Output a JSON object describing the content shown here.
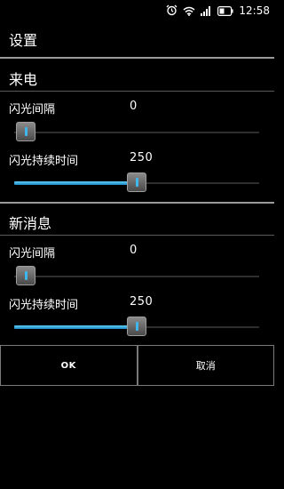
{
  "status_bar": {
    "time": "12:58",
    "icons": [
      "alarm-icon",
      "wifi-icon",
      "signal-icon",
      "battery-icon"
    ]
  },
  "header": {
    "title": "设置"
  },
  "sections": [
    {
      "title": "来电",
      "prefs": [
        {
          "label": "闪光间隔",
          "value": "0",
          "slider_fraction": 0.0
        },
        {
          "label": "闪光持续时间",
          "value": "250",
          "slider_fraction": 0.5
        }
      ]
    },
    {
      "title": "新消息",
      "prefs": [
        {
          "label": "闪光间隔",
          "value": "0",
          "slider_fraction": 0.0
        },
        {
          "label": "闪光持续时间",
          "value": "250",
          "slider_fraction": 0.5
        }
      ]
    }
  ],
  "buttons": {
    "ok_label": "OK",
    "cancel_label": "取消"
  },
  "colors": {
    "accent": "#33b5e5",
    "background": "#000000",
    "divider": "#9a9a9a"
  }
}
